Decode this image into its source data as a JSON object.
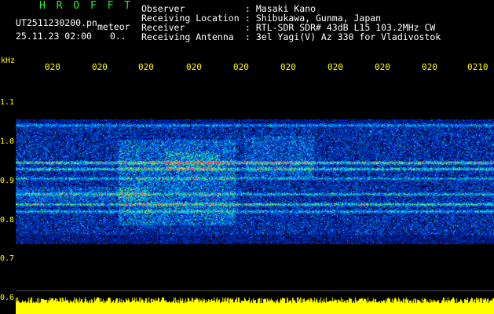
{
  "header": {
    "title": "H R O F F T",
    "filename": "UT2511230200.pn",
    "meteor_label": "meteor",
    "datetime": "25.11.23 02:00",
    "count": "0.."
  },
  "info": [
    {
      "label": "Observer",
      "value": ": Masaki Kano"
    },
    {
      "label": "Receiving Location",
      "value": ": Shibukawa, Gunma, Japan"
    },
    {
      "label": "Receiver",
      "value": ": RTL-SDR SDR# 43dB L15 103.2MHz CW"
    },
    {
      "label": "Receiving Antenna",
      "value": ": 3el Yagi(V) Az 330 for Vladivostok"
    }
  ],
  "axis": {
    "unit": "kHz",
    "y_ticks": [
      "1.1",
      "1.0",
      "0.9",
      "0.8",
      "0.7",
      "0.6"
    ],
    "x_ticks": [
      "020",
      "020",
      "020",
      "020",
      "020",
      "020",
      "020",
      "020",
      "020",
      "0210"
    ],
    "y_range_khz": [
      0.6,
      1.1
    ]
  },
  "colors": {
    "background": "#000000",
    "title": "#35e835",
    "axis_text": "#ffff00",
    "info_text": "#ffffff",
    "echo_strong": "#ff2060"
  }
}
